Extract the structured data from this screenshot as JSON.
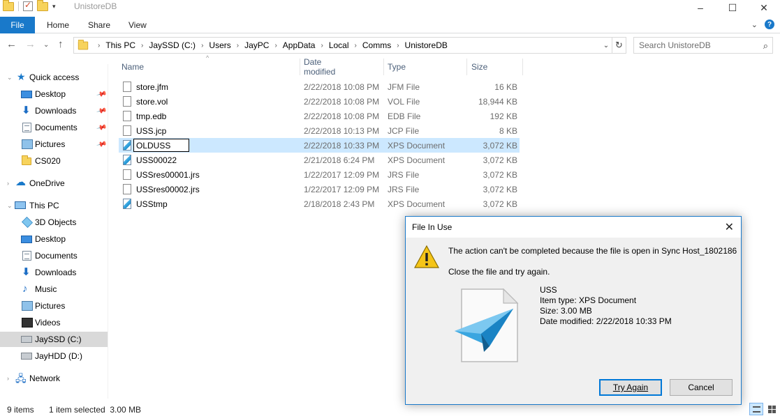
{
  "window": {
    "title": "UnistoreDB",
    "controls": {
      "minimize": "–",
      "maximize": "☐",
      "close": "✕"
    }
  },
  "ribbon": {
    "tabs": [
      "File",
      "Home",
      "Share",
      "View"
    ],
    "expand_glyph": "⌄",
    "help_glyph": "?"
  },
  "navigation": {
    "back": "←",
    "forward": "→",
    "recent": "⌄",
    "up": "↑",
    "breadcrumbs": [
      "This PC",
      "JaySSD (C:)",
      "Users",
      "JayPC",
      "AppData",
      "Local",
      "Comms",
      "UnistoreDB"
    ],
    "refresh_glyph": "↻",
    "search_placeholder": "Search UnistoreDB"
  },
  "sidebar": {
    "items": [
      {
        "label": "Quick access",
        "icon": "star-icon",
        "pinned": false
      },
      {
        "label": "Desktop",
        "icon": "desktop-icon",
        "pinned": true
      },
      {
        "label": "Downloads",
        "icon": "download-icon",
        "pinned": true
      },
      {
        "label": "Documents",
        "icon": "documents-icon",
        "pinned": true
      },
      {
        "label": "Pictures",
        "icon": "pictures-icon",
        "pinned": true
      },
      {
        "label": "CS020",
        "icon": "folder-icon",
        "pinned": false
      },
      {
        "label": "OneDrive",
        "icon": "cloud-icon",
        "pinned": false
      },
      {
        "label": "This PC",
        "icon": "computer-icon",
        "pinned": false
      },
      {
        "label": "3D Objects",
        "icon": "cube-icon",
        "pinned": false
      },
      {
        "label": "Desktop",
        "icon": "desktop-icon",
        "pinned": false
      },
      {
        "label": "Documents",
        "icon": "documents-icon",
        "pinned": false
      },
      {
        "label": "Downloads",
        "icon": "download-icon",
        "pinned": false
      },
      {
        "label": "Music",
        "icon": "music-icon",
        "pinned": false
      },
      {
        "label": "Pictures",
        "icon": "pictures-icon",
        "pinned": false
      },
      {
        "label": "Videos",
        "icon": "video-icon",
        "pinned": false
      },
      {
        "label": "JaySSD (C:)",
        "icon": "drive-icon",
        "pinned": false
      },
      {
        "label": "JayHDD (D:)",
        "icon": "drive-icon",
        "pinned": false
      },
      {
        "label": "Network",
        "icon": "network-icon",
        "pinned": false
      }
    ]
  },
  "file_list": {
    "columns": [
      "Name",
      "Date modified",
      "Type",
      "Size"
    ],
    "rows": [
      {
        "name": "store.jfm",
        "date": "2/22/2018 10:08 PM",
        "type": "JFM File",
        "size": "16 KB"
      },
      {
        "name": "store.vol",
        "date": "2/22/2018 10:08 PM",
        "type": "VOL File",
        "size": "18,944 KB"
      },
      {
        "name": "tmp.edb",
        "date": "2/22/2018 10:08 PM",
        "type": "EDB File",
        "size": "192 KB"
      },
      {
        "name": "USS.jcp",
        "date": "2/22/2018 10:13 PM",
        "type": "JCP File",
        "size": "8 KB"
      },
      {
        "name": "OLDUSS",
        "date": "2/22/2018 10:33 PM",
        "type": "XPS Document",
        "size": "3,072 KB"
      },
      {
        "name": "USS00022",
        "date": "2/21/2018 6:24 PM",
        "type": "XPS Document",
        "size": "3,072 KB"
      },
      {
        "name": "USSres00001.jrs",
        "date": "1/22/2017 12:09 PM",
        "type": "JRS File",
        "size": "3,072 KB"
      },
      {
        "name": "USSres00002.jrs",
        "date": "1/22/2017 12:09 PM",
        "type": "JRS File",
        "size": "3,072 KB"
      },
      {
        "name": "USStmp",
        "date": "2/18/2018 2:43 PM",
        "type": "XPS Document",
        "size": "3,072 KB"
      }
    ]
  },
  "status_bar": {
    "item_count": "9 items",
    "selection": "1 item selected  3.00 MB"
  },
  "dialog": {
    "title": "File In Use",
    "message": "The action can't be completed because the file is open in Sync Host_1802186",
    "instruction": "Close the file and try again.",
    "file_name": "USS",
    "item_type": "Item type: XPS Document",
    "size": "Size: 3.00 MB",
    "date_modified": "Date modified: 2/22/2018 10:33 PM",
    "try_again": "Try Again",
    "cancel": "Cancel",
    "close_glyph": "✕"
  },
  "colors": {
    "accent": "#1979ca",
    "selection": "#cce8ff",
    "warning": "#f5c518"
  }
}
